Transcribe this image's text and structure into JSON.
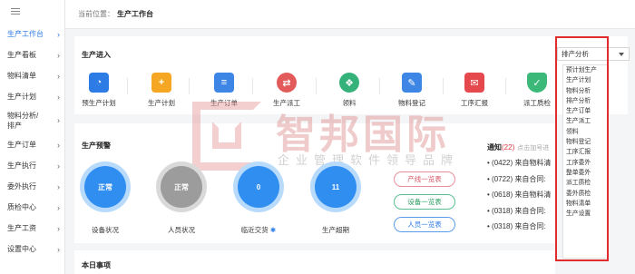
{
  "sidebar": {
    "items": [
      {
        "label": "生产工作台",
        "active": true
      },
      {
        "label": "生产看板"
      },
      {
        "label": "物料清单"
      },
      {
        "label": "生产计划"
      },
      {
        "label": "物料分析/排产"
      },
      {
        "label": "生产订单"
      },
      {
        "label": "生产执行"
      },
      {
        "label": "委外执行"
      },
      {
        "label": "质检中心"
      },
      {
        "label": "生产工资"
      },
      {
        "label": "设置中心"
      }
    ]
  },
  "breadcrumb": {
    "label": "当前位置：",
    "current": "生产工作台"
  },
  "entry_panel": {
    "title": "生产进入",
    "entries": [
      {
        "label": "预生产计划",
        "icon": "pre-plan-icon",
        "color": "#2d7be5"
      },
      {
        "label": "生产计划",
        "icon": "plan-icon",
        "color": "#f5a623"
      },
      {
        "label": "生产订单",
        "icon": "order-icon",
        "color": "#3e86e6"
      },
      {
        "label": "生产派工",
        "icon": "dispatch-icon",
        "color": "#e25a5a"
      },
      {
        "label": "领料",
        "icon": "pick-material-icon",
        "color": "#35b27a"
      },
      {
        "label": "物料登记",
        "icon": "material-register-icon",
        "color": "#3e86e6"
      },
      {
        "label": "工序汇报",
        "icon": "process-report-icon",
        "color": "#e5484d"
      },
      {
        "label": "派工质检",
        "icon": "quality-check-icon",
        "color": "#3cb878"
      }
    ]
  },
  "select": {
    "value": "排产分析"
  },
  "dropdown": {
    "options": [
      "预计划生产",
      "生产计划",
      "物料分析",
      "排产分析",
      "生产订单",
      "生产派工",
      "领料",
      "物料登记",
      "工序汇报",
      "工序委外",
      "整单委外",
      "派工质检",
      "委外质检",
      "物料清单",
      "生产设置"
    ]
  },
  "warning_panel": {
    "title": "生产预警",
    "circles": [
      {
        "value": "正常",
        "label": "设备状况",
        "style": "blue"
      },
      {
        "value": "正常",
        "label": "人员状况",
        "style": "gray"
      },
      {
        "value": "0",
        "label": "临近交货",
        "style": "blue"
      },
      {
        "value": "11",
        "label": "生产超期",
        "style": "blue"
      }
    ],
    "buttons": [
      "产线一览表",
      "设备一览表",
      "人员一览表"
    ]
  },
  "notices": {
    "title": "通知",
    "count": "(22)",
    "tip": "点击加号进",
    "items": [
      "(0422) 来自物料清",
      "(0722) 来自合同:",
      "(0618) 来自物料清",
      "(0318) 来自合同:",
      "(0318) 来自合同:"
    ]
  },
  "today_panel": {
    "title": "本日事项"
  },
  "watermark": {
    "name": "智邦国际",
    "slogan": "企业管理软件领导品牌"
  }
}
